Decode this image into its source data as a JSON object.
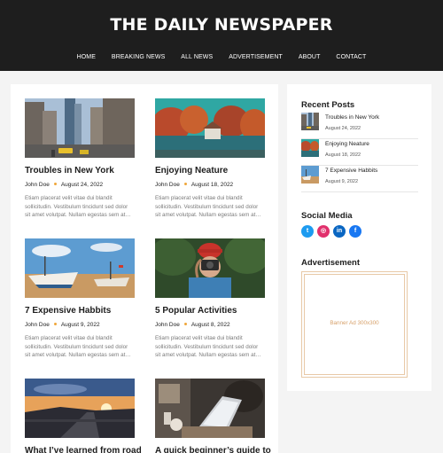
{
  "site": {
    "title": "THE DAILY NEWSPAPER"
  },
  "nav": [
    "HOME",
    "BREAKING NEWS",
    "ALL NEWS",
    "ADVERTISEMENT",
    "ABOUT",
    "CONTACT"
  ],
  "posts": [
    {
      "title": "Troubles in New York",
      "author": "John Doe",
      "date": "August 24, 2022",
      "excerpt": "Etiam placerat velit vitae dui blandit sollicitudin. Vestibulum tincidunt sed dolor sit amet volutpat. Nullam egestas sem at…"
    },
    {
      "title": "Enjoying Neature",
      "author": "John Doe",
      "date": "August 18, 2022",
      "excerpt": "Etiam placerat velit vitae dui blandit sollicitudin. Vestibulum tincidunt sed dolor sit amet volutpat. Nullam egestas sem at…"
    },
    {
      "title": "7 Expensive Habbits",
      "author": "John Doe",
      "date": "August 9, 2022",
      "excerpt": "Etiam placerat velit vitae dui blandit sollicitudin. Vestibulum tincidunt sed dolor sit amet volutpat. Nullam egestas sem at…"
    },
    {
      "title": "5 Popular Activities",
      "author": "John Doe",
      "date": "August 8, 2022",
      "excerpt": "Etiam placerat velit vitae dui blandit sollicitudin. Vestibulum tincidunt sed dolor sit amet volutpat. Nullam egestas sem at…"
    },
    {
      "title": "What I’ve learned from road",
      "author": "",
      "date": "",
      "excerpt": ""
    },
    {
      "title": "A quick beginner’s guide to",
      "author": "",
      "date": "",
      "excerpt": ""
    }
  ],
  "sidebar": {
    "recent_title": "Recent Posts",
    "recent": [
      {
        "title": "Troubles in New York",
        "date": "August 24, 2022"
      },
      {
        "title": "Enjoying Neature",
        "date": "August 18, 2022"
      },
      {
        "title": "7 Expensive Habbits",
        "date": "August 9, 2022"
      }
    ],
    "social_title": "Social Media",
    "social": [
      {
        "name": "twitter-icon",
        "glyph": "t",
        "color": "#1d9bf0"
      },
      {
        "name": "instagram-icon",
        "glyph": "◎",
        "color": "#e1306c"
      },
      {
        "name": "linkedin-icon",
        "glyph": "in",
        "color": "#0a66c2"
      },
      {
        "name": "facebook-icon",
        "glyph": "f",
        "color": "#1877f2"
      }
    ],
    "ad_title": "Advertisement",
    "ad_text": "Banner Ad 300x300"
  },
  "colors": {
    "header_bg": "#1e1e1e",
    "accent_dot": "#f0a63a",
    "ad_border": "#e8c9a7"
  }
}
